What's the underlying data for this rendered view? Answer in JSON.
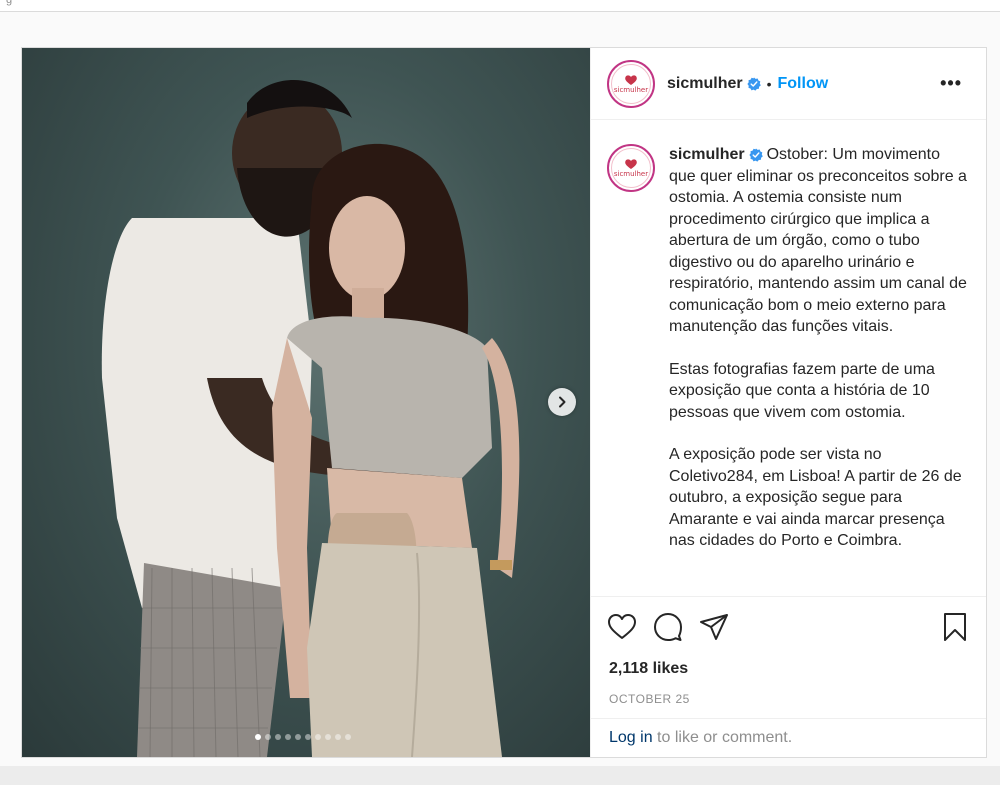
{
  "account": {
    "username": "sicmulher",
    "logo_text": "sicmulher",
    "follow_label": "Follow",
    "separator": "•",
    "more_label": "•••"
  },
  "caption": {
    "paragraphs": [
      "Ostober: Um movimento que quer eliminar os preconceitos sobre a ostomia. A ostemia consiste num procedimento cirúrgico que implica a abertura de um órgão, como o tubo digestivo ou do aparelho urinário e respiratório, mantendo assim um canal de comunicação bom o meio externo para manutenção das funções vitais.",
      "Estas fotografias fazem parte de uma exposição que conta a história de 10 pessoas que vivem com ostomia.",
      "A exposição pode ser vista no Coletivo284, em Lisboa! A partir de 26 de outubro, a exposição segue para Amarante e vai ainda marcar presença nas cidades do Porto e Coimbra."
    ]
  },
  "media": {
    "carousel_count": 10,
    "active_index": 0
  },
  "stats": {
    "likes": "2,118 likes",
    "date": "OCTOBER 25"
  },
  "footer": {
    "login_link": "Log in",
    "login_rest": " to like or comment."
  },
  "icons": {
    "like": "heart-icon",
    "comment": "comment-icon",
    "share": "share-icon",
    "save": "bookmark-icon",
    "verified": "verified-badge-icon",
    "next": "chevron-right-icon"
  },
  "colors": {
    "link_blue": "#0095f6",
    "verified_blue": "#3897f0",
    "muted": "#8e8e8e",
    "text": "#262626",
    "brand_red": "#c7344a"
  }
}
